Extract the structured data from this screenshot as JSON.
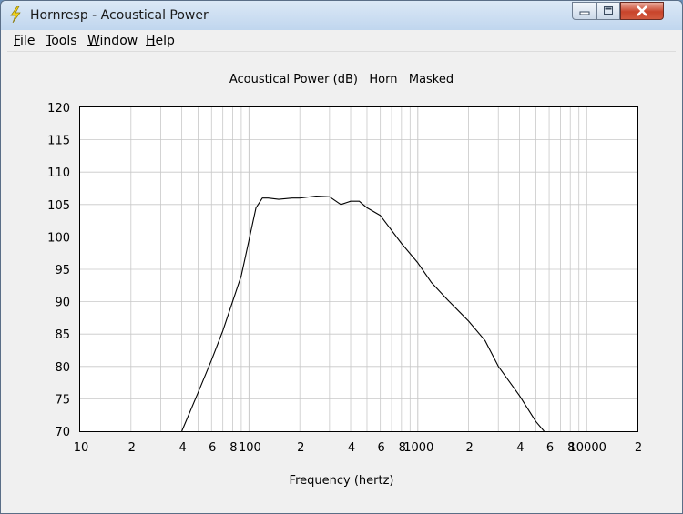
{
  "window": {
    "title": "Hornresp - Acoustical Power"
  },
  "menu": {
    "items": [
      {
        "first": "F",
        "rest": "ile"
      },
      {
        "first": "T",
        "rest": "ools"
      },
      {
        "first": "W",
        "rest": "indow"
      },
      {
        "first": "H",
        "rest": "elp"
      }
    ]
  },
  "colors": {
    "curve": "#000000",
    "grid": "#c8c8c8",
    "plot_bg": "#ffffff",
    "window_bg": "#f0f0f0"
  },
  "chart_data": {
    "type": "line",
    "title": "Acoustical Power (dB)   Horn   Masked",
    "xlabel": "Frequency (hertz)",
    "ylabel": "",
    "x_scale": "log",
    "xlim": [
      10,
      20000
    ],
    "ylim": [
      70,
      120
    ],
    "y_ticks": [
      120,
      115,
      110,
      105,
      100,
      95,
      90,
      85,
      80,
      75,
      70
    ],
    "x_tick_labels": [
      {
        "value": 10,
        "label": "10"
      },
      {
        "value": 20,
        "label": "2"
      },
      {
        "value": 40,
        "label": "4"
      },
      {
        "value": 60,
        "label": "6"
      },
      {
        "value": 80,
        "label": "8"
      },
      {
        "value": 100,
        "label": "100"
      },
      {
        "value": 200,
        "label": "2"
      },
      {
        "value": 400,
        "label": "4"
      },
      {
        "value": 600,
        "label": "6"
      },
      {
        "value": 800,
        "label": "8"
      },
      {
        "value": 1000,
        "label": "1000"
      },
      {
        "value": 2000,
        "label": "2"
      },
      {
        "value": 4000,
        "label": "4"
      },
      {
        "value": 6000,
        "label": "6"
      },
      {
        "value": 8000,
        "label": "8"
      },
      {
        "value": 10000,
        "label": "10000"
      },
      {
        "value": 20000,
        "label": "2"
      }
    ],
    "grid": true,
    "series": [
      {
        "x": [
          40,
          50,
          60,
          70,
          80,
          90,
          100,
          110,
          120,
          130,
          150,
          180,
          200,
          250,
          300,
          350,
          400,
          450,
          500,
          600,
          700,
          800,
          1000,
          1200,
          1500,
          2000,
          2500,
          3000,
          4000,
          5000,
          5600
        ],
        "y": [
          70,
          76,
          81,
          85.5,
          90,
          94,
          99.5,
          104.5,
          106,
          106,
          105.8,
          106,
          106,
          106.3,
          106.2,
          105,
          105.5,
          105.5,
          104.5,
          103.3,
          101,
          99,
          96,
          93,
          90.3,
          87,
          84,
          80,
          75.5,
          71.5,
          70
        ]
      }
    ]
  }
}
